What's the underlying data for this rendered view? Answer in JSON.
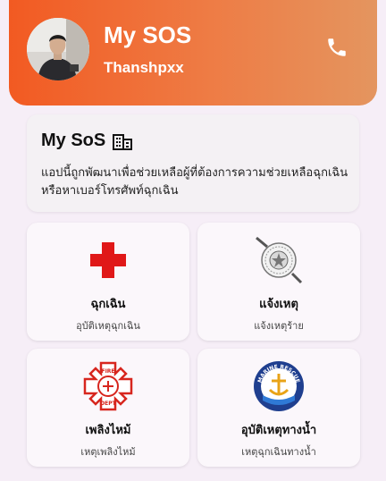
{
  "header": {
    "title": "My SOS",
    "username": "Thanshpxx",
    "call_icon": "phone-icon",
    "gradient": [
      "#f25a22",
      "#e4955f"
    ]
  },
  "info": {
    "title": "My SoS",
    "title_icon": "building-icon",
    "description": "แอปนี้ถูกพัฒนาเพื่อช่วยเหลือผู้ที่ต้องการความช่วยเหลือฉุกเฉิน หรือหาเบอร์โทรศัพท์ฉุกเฉิน"
  },
  "tiles": [
    {
      "title": "ฉุกเฉิน",
      "subtitle": "อุบัติเหตุฉุกเฉิน",
      "icon": "red-cross-icon"
    },
    {
      "title": "แจ้งเหตุ",
      "subtitle": "แจ้งเหตุร้าย",
      "icon": "police-badge-icon"
    },
    {
      "title": "เพลิงไหม้",
      "subtitle": "เหตุเพลิงไหม้",
      "icon": "fire-department-icon"
    },
    {
      "title": "อุบัติเหตุทางน้ำ",
      "subtitle": "เหตุฉุกเฉินทางน้ำ",
      "icon": "marine-rescue-icon"
    }
  ],
  "logo_text": {
    "fire_top": "FIRE",
    "fire_bottom": "DEPT",
    "marine": "MARINE RESCUE"
  }
}
